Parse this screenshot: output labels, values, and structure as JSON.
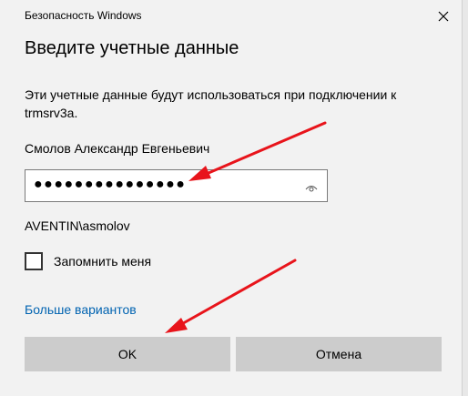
{
  "titlebar": {
    "title": "Безопасность Windows",
    "close_icon": "close-icon"
  },
  "dialog": {
    "heading": "Введите учетные данные",
    "description": "Эти учетные данные будут использоваться при подключении к trmsrv3a.",
    "username": "Смолов Александр Евгеньевич",
    "password_masked": "●●●●●●●●●●●●●●●",
    "reveal_icon": "eye-icon",
    "domain_user": "AVENTIN\\asmolov",
    "remember": {
      "label": "Запомнить меня",
      "checked": false
    },
    "more_options": "Больше вариантов",
    "ok_label": "OK",
    "cancel_label": "Отмена"
  },
  "annotation_color": "#e8141b",
  "link_color": "#0063b1"
}
